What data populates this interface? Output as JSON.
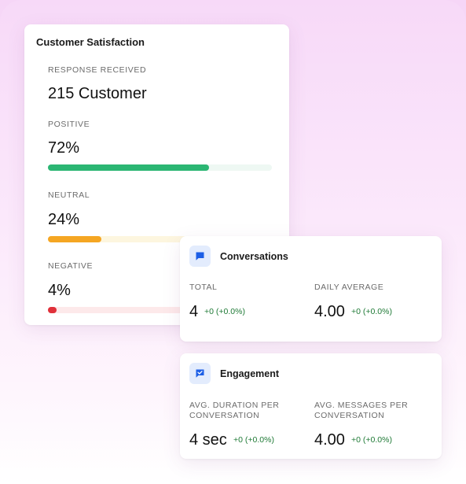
{
  "satisfaction": {
    "title": "Customer Satisfaction",
    "response_label": "RESPONSE RECEIVED",
    "response_value": "215 Customer",
    "positive": {
      "label": "POSITIVE",
      "value": "72%",
      "fraction": 0.72,
      "color": "#2bb673",
      "track": "#eef8f3"
    },
    "neutral": {
      "label": "NEUTRAL",
      "value": "24%",
      "fraction": 0.24,
      "color": "#f5a623",
      "track": "#fdf6df"
    },
    "negative": {
      "label": "NEGATIVE",
      "value": "4%",
      "fraction": 0.04,
      "color": "#e0303a",
      "track": "#fde9ea"
    }
  },
  "conversations": {
    "icon": "chat-bubble-icon",
    "title": "Conversations",
    "total_label": "TOTAL",
    "total_value": "4",
    "total_delta": "+0 (+0.0%)",
    "daily_label": "DAILY AVERAGE",
    "daily_value": "4.00",
    "daily_delta": "+0 (+0.0%)"
  },
  "engagement": {
    "icon": "chat-check-icon",
    "title": "Engagement",
    "duration_label_1": "AVG. DURATION PER",
    "duration_label_2": "CONVERSATION",
    "duration_value": "4 sec",
    "duration_delta": "+0 (+0.0%)",
    "messages_label_1": "AVG. MESSAGES PER",
    "messages_label_2": "CONVERSATION",
    "messages_value": "4.00",
    "messages_delta": "+0 (+0.0%)"
  },
  "colors": {
    "accent_blue": "#1d5fe6",
    "delta_green": "#1f7a36"
  }
}
